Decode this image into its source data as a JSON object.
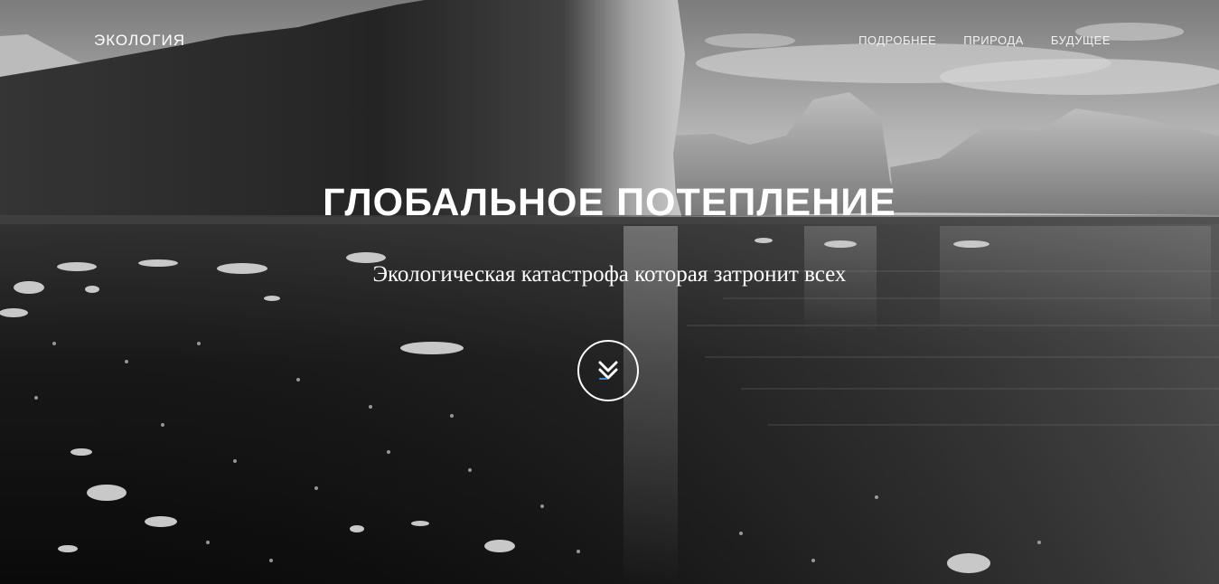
{
  "brand": {
    "label": "ЭКОЛОГИЯ"
  },
  "nav": {
    "items": [
      {
        "label": "ПОДРОБНЕЕ"
      },
      {
        "label": "ПРИРОДА"
      },
      {
        "label": "БУДУЩЕЕ"
      }
    ]
  },
  "hero": {
    "title": "ГЛОБАЛЬНОЕ ПОТЕПЛЕНИЕ",
    "subtitle": "Экологическая катастрофа которая затронит всех",
    "scroll_icon": "double-chevron-down-icon",
    "background_image": "grayscale-icebergs-sea-photo"
  },
  "colors": {
    "text": "#ffffff",
    "accent": "#3a8fd8"
  }
}
